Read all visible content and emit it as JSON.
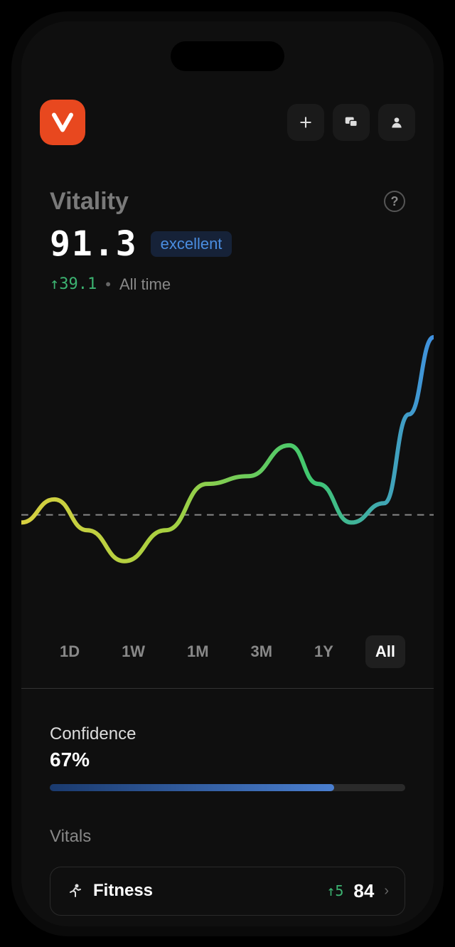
{
  "header": {
    "title": "Vitality",
    "score": "91.3",
    "rating": "excellent",
    "delta": "↑39.1",
    "period": "All time"
  },
  "ranges": [
    {
      "label": "1D",
      "active": false
    },
    {
      "label": "1W",
      "active": false
    },
    {
      "label": "1M",
      "active": false
    },
    {
      "label": "3M",
      "active": false
    },
    {
      "label": "1Y",
      "active": false
    },
    {
      "label": "All",
      "active": true
    }
  ],
  "confidence": {
    "label": "Confidence",
    "value": "67%",
    "percent": 80
  },
  "vitals": {
    "title": "Vitals",
    "items": [
      {
        "name": "Fitness",
        "delta": "↑5",
        "score": "84"
      }
    ]
  },
  "chart_data": {
    "type": "line",
    "title": "Vitality",
    "xlabel": "",
    "ylabel": "",
    "baseline": 52,
    "x": [
      0,
      8,
      16,
      25,
      35,
      45,
      55,
      65,
      72,
      80,
      88,
      94,
      100
    ],
    "values": [
      50,
      56,
      48,
      40,
      48,
      60,
      62,
      70,
      60,
      50,
      55,
      78,
      98
    ],
    "ylim": [
      30,
      100
    ],
    "gradient_colors": [
      "#e0d040",
      "#9ed040",
      "#40d080",
      "#40a0e0"
    ]
  }
}
